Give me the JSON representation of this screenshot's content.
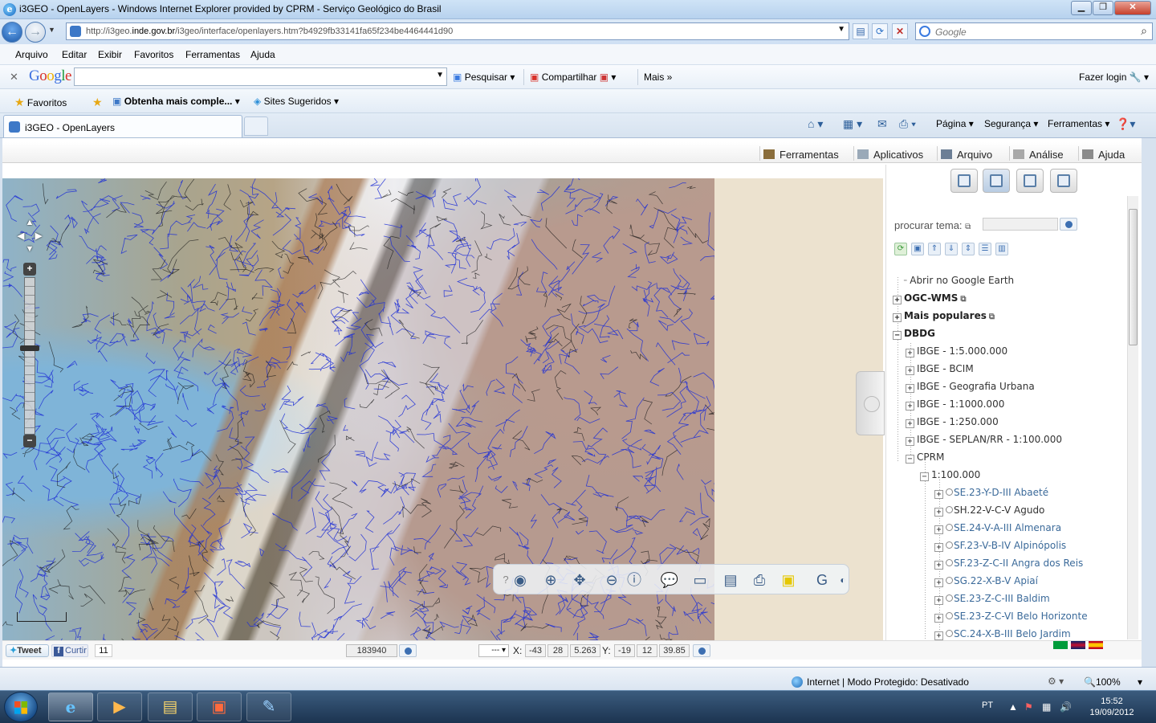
{
  "window": {
    "title": "i3GEO - OpenLayers - Windows Internet Explorer provided by CPRM - Serviço Geológico do Brasil",
    "url_prefix": "http://i3geo.",
    "url_host": "inde.gov.br",
    "url_rest": "/i3geo/interface/openlayers.htm?b4929fb33141fa65f234be4464441d90",
    "search_placeholder": "Google"
  },
  "menubar": [
    "Arquivo",
    "Editar",
    "Exibir",
    "Favoritos",
    "Ferramentas",
    "Ajuda"
  ],
  "googlebar": {
    "logo": "Google",
    "pesquisar": "Pesquisar",
    "compartilhar": "Compartilhar",
    "mais": "Mais",
    "login": "Fazer login"
  },
  "favorites": {
    "favoritos": "Favoritos",
    "obtenha": "Obtenha mais comple...",
    "sites": "Sites Sugeridos"
  },
  "tab": {
    "title": "i3GEO - OpenLayers"
  },
  "commandbar": {
    "pagina": "Página",
    "seguranca": "Segurança",
    "ferramentas": "Ferramentas"
  },
  "app_menu": [
    "Ferramentas",
    "Aplicativos",
    "Arquivo",
    "Análise",
    "Ajuda"
  ],
  "side_panel": {
    "search_label": "procurar tema:",
    "tree": {
      "google_earth": "Abrir no Google Earth",
      "groups": [
        "OGC-WMS",
        "Mais populares",
        "DBDG"
      ],
      "dbdg_children": [
        "IBGE - 1:5.000.000",
        "IBGE - BCIM",
        "IBGE - Geografia Urbana",
        "IBGE - 1:1000.000",
        "IBGE - 1:250.000",
        "IBGE - SEPLAN/RR - 1:100.000",
        "CPRM"
      ],
      "cprm_children": [
        "1:100.000"
      ],
      "sheets": [
        "SE.23-Y-D-III Abaeté",
        "SH.22-V-C-V Agudo",
        "SE.24-V-A-III Almenara",
        "SF.23-V-B-IV Alpinópolis",
        "SF.23-Z-C-II Angra dos Reis",
        "SG.22-X-B-V Apiaí",
        "SE.23-Z-C-III Baldim",
        "SE.23-Z-C-VI Belo Horizonte",
        "SC.24-X-B-III Belo Jardim"
      ]
    }
  },
  "bottom": {
    "tweet": "Tweet",
    "curtir": "Curtir",
    "like_count": "11",
    "scale": "183940",
    "coord_select": "---",
    "x_label": "X:",
    "x_deg": "-43",
    "x_min": "28",
    "x_sec": "5.263",
    "y_label": "Y:",
    "y_deg": "-19",
    "y_min": "12",
    "y_sec": "39.85"
  },
  "statusbar": {
    "zone": "Internet | Modo Protegido: Desativado",
    "zoom": "100%"
  },
  "taskbar": {
    "lang": "PT",
    "time": "15:52",
    "date": "19/09/2012"
  }
}
